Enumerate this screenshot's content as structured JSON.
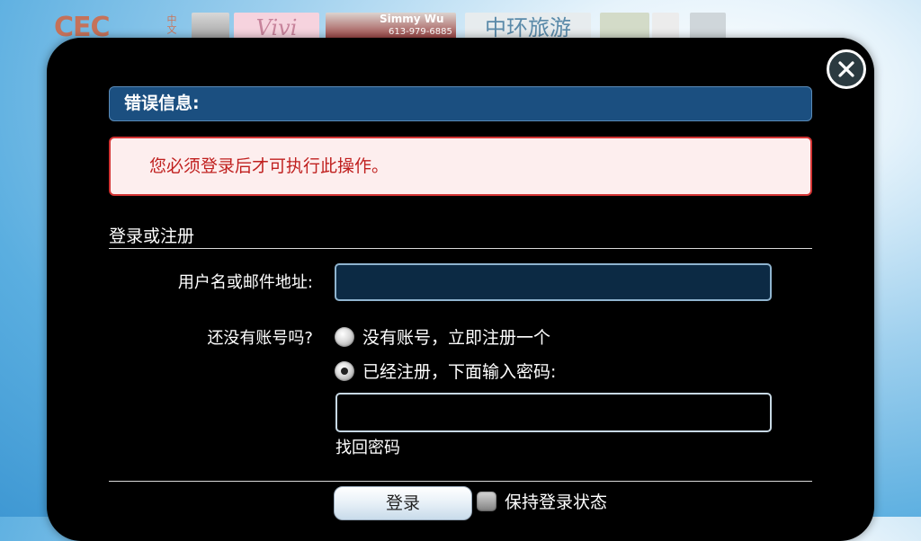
{
  "background_banner": {
    "logo_text": "CEC",
    "logo_sub": "中文",
    "tile_vivi": "Vivi",
    "tile_simmy_name": "Simmy Wu",
    "tile_simmy_phone": "613-979-6885",
    "tile_zhonghuan": "中环旅游"
  },
  "modal": {
    "error_header": "错误信息:",
    "error_message": "您必须登录后才可执行此操作。",
    "section_title": "登录或注册",
    "username_label": "用户名或邮件地址:",
    "username_value": "",
    "account_question": "还没有账号吗?",
    "radio_register": "没有账号，立即注册一个",
    "radio_register_checked": false,
    "radio_password": "已经注册，下面输入密码:",
    "radio_password_checked": true,
    "password_value": "",
    "forgot_password": "找回密码",
    "login_button": "登录",
    "keep_logged_in": "保持登录状态",
    "keep_logged_in_checked": false
  },
  "icons": {
    "close": "close-icon"
  },
  "colors": {
    "header_blue": "#1b4f80",
    "error_red": "#d43434",
    "error_bg": "#fdeeee"
  }
}
